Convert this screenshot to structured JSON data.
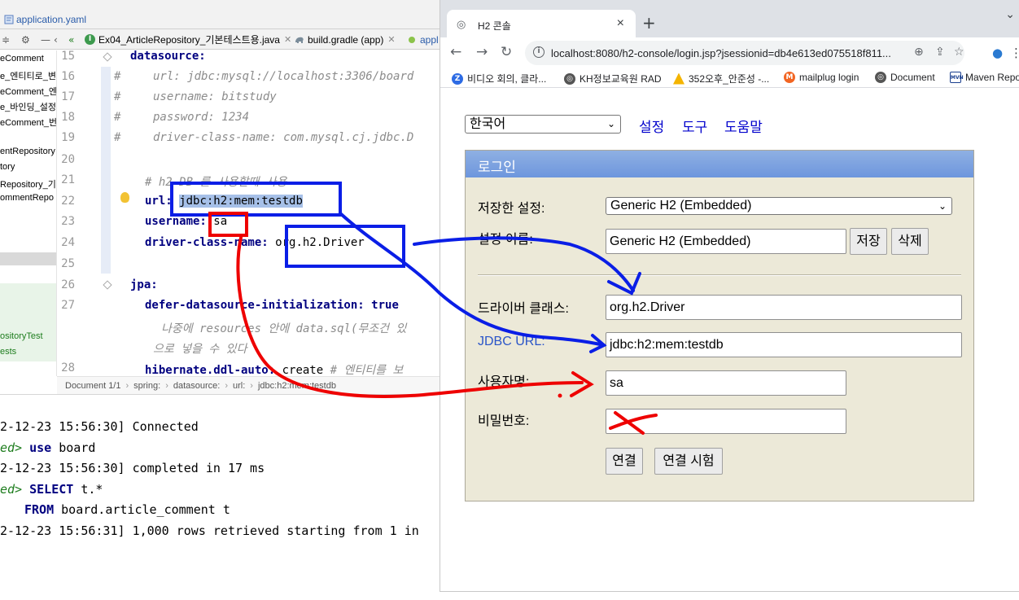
{
  "ide": {
    "file_tab": "application.yaml",
    "editor_tabs": [
      {
        "label": "Ex04_ArticleRepository_기본테스트용.java"
      },
      {
        "label": "build.gradle (app)"
      },
      {
        "label": "appl"
      }
    ],
    "project_items": [
      "eComment",
      "e_엔티티로_변",
      "eComment_엔",
      "e_바인딩_설정",
      "eComment_번",
      "entRepository",
      "tory",
      "Repository_기본",
      "ommentRepo",
      "ositoryTest",
      "ests"
    ],
    "line_numbers": [
      "15",
      "16",
      "17",
      "18",
      "19",
      "20",
      "21",
      "22",
      "23",
      "24",
      "25",
      "26",
      "27",
      "28"
    ],
    "code": {
      "l15": "datasource:",
      "l16_key": "url:",
      "l16_val": "jdbc:mysql://localhost:3306/board",
      "l17_key": "username:",
      "l17_val": "bitstudy",
      "l18_key": "password:",
      "l18_val": "1234",
      "l19_key": "driver-class-name:",
      "l19_val": "com.mysql.cj.jdbc.D",
      "l21": "# h2 DB 를 사용할때 사용",
      "l22_key": "url:",
      "l22_val": "jdbc:h2:mem:testdb",
      "l23_key": "username:",
      "l23_val": "sa",
      "l24_key": "driver-class-name:",
      "l24_val": "org.h2.Driver",
      "l26": "jpa:",
      "l27_key": "defer-datasource-initialization:",
      "l27_val": "true",
      "l27_cont1": "나중에 resources 안에 data.sql(무조건 있",
      "l27_cont2": "으로 넣을 수 있다",
      "l28_key": "hibernate.ddl-auto:",
      "l28_val": "create",
      "l28_com": "# 엔티티를 보"
    },
    "comment_hash": "#",
    "breadcrumb": [
      "Document 1/1",
      "spring:",
      "datasource:",
      "url:",
      "jdbc:h2:mem:testdb"
    ],
    "console": [
      {
        "prefix": "2-12-23 15:56:30]",
        "text": "Connected"
      },
      {
        "prefix": "ed>",
        "kw": "use",
        "text": "board"
      },
      {
        "prefix": "2-12-23 15:56:30]",
        "text": "completed in 17 ms"
      },
      {
        "prefix": "ed>",
        "kw": "SELECT",
        "text": "t.*"
      },
      {
        "prefix": "",
        "kw": "FROM",
        "text": "board.article_comment t"
      },
      {
        "prefix": "2-12-23 15:56:31]",
        "text": "1,000 rows retrieved starting from 1 in"
      }
    ]
  },
  "browser": {
    "tab_title": "H2 콘솔",
    "url": "localhost:8080/h2-console/login.jsp?jsessionid=db4e613ed075518f811...",
    "bookmarks": [
      "비디오 회의, 클라...",
      "KH정보교육원 RAD",
      "352오후_안준성 -...",
      "mailplug login",
      "Document",
      "Maven Repo"
    ]
  },
  "h2": {
    "language": "한국어",
    "links": [
      "설정",
      "도구",
      "도움말"
    ],
    "login_title": "로그인",
    "saved_settings_label": "저장한 설정:",
    "saved_settings_value": "Generic H2 (Embedded)",
    "setting_name_label": "설정 이름:",
    "setting_name_value": "Generic H2 (Embedded)",
    "save_button": "저장",
    "delete_button": "삭제",
    "driver_label": "드라이버 클래스:",
    "driver_value": "org.h2.Driver",
    "jdbc_label": "JDBC URL:",
    "jdbc_value": "jdbc:h2:mem:testdb",
    "user_label": "사용자명:",
    "user_value": "sa",
    "password_label": "비밀번호:",
    "connect_button": "연결",
    "test_button": "연결 시험"
  },
  "colors": {
    "annotation_blue": "#0a1ee6",
    "annotation_red": "#ee0000",
    "h2_panel": "#ece9d8",
    "h2_header": "#7aa0e0",
    "yaml_key": "#000080"
  }
}
